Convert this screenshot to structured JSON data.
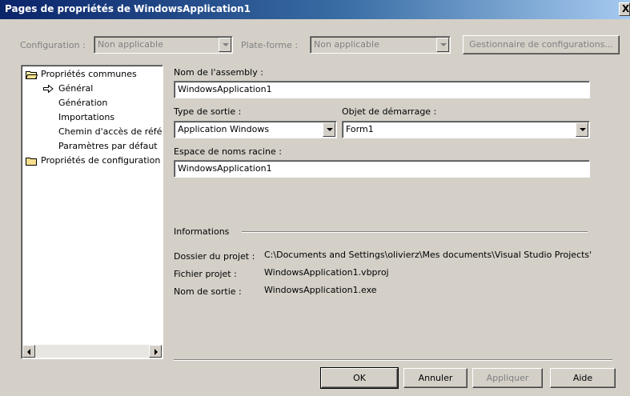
{
  "window": {
    "title": "Pages de propriétés de WindowsApplication1",
    "close_glyph": "X"
  },
  "config_bar": {
    "configuration_label": "Configuration :",
    "configuration_value": "Non applicable",
    "platform_label": "Plate-forme :",
    "platform_value": "Non applicable",
    "config_manager_button": "Gestionnaire de configurations..."
  },
  "tree": {
    "items": [
      {
        "label": "Propriétés communes",
        "icon": "folder-open-icon"
      },
      {
        "label": "Général",
        "icon": "arrow-right-icon"
      },
      {
        "label": "Génération"
      },
      {
        "label": "Importations"
      },
      {
        "label": "Chemin d'accès de réfé"
      },
      {
        "label": "Paramètres par défaut"
      },
      {
        "label": "Propriétés de configuration",
        "icon": "folder-icon"
      }
    ]
  },
  "form": {
    "assembly_name_label": "Nom de l'assembly :",
    "assembly_name_value": "WindowsApplication1",
    "output_type_label": "Type de sortie :",
    "output_type_value": "Application Windows",
    "startup_object_label": "Objet de démarrage :",
    "startup_object_value": "Form1",
    "root_namespace_label": "Espace de noms racine :",
    "root_namespace_value": "WindowsApplication1"
  },
  "info": {
    "heading": "Informations",
    "project_folder_label": "Dossier du projet :",
    "project_folder_value": "C:\\Documents and Settings\\olivierz\\Mes documents\\Visual Studio Projects'",
    "project_file_label": "Fichier projet :",
    "project_file_value": "WindowsApplication1.vbproj",
    "output_name_label": "Nom de sortie :",
    "output_name_value": "WindowsApplication1.exe"
  },
  "buttons": {
    "ok": "OK",
    "cancel": "Annuler",
    "apply": "Appliquer",
    "help": "Aide"
  }
}
